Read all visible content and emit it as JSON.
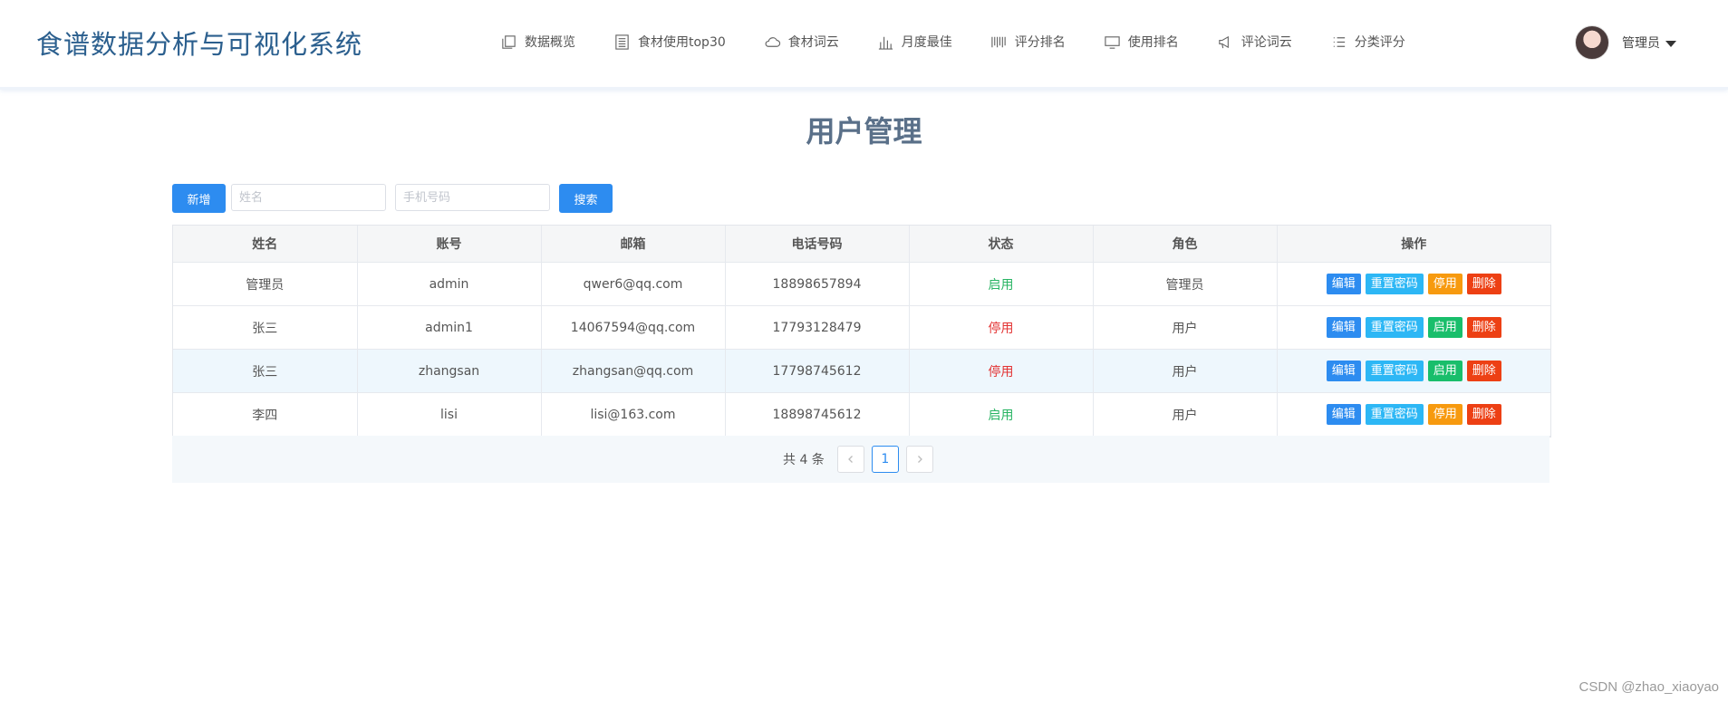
{
  "header": {
    "brand": "食谱数据分析与可视化系统",
    "nav": [
      {
        "label": "数据概览",
        "icon": "copy-icon"
      },
      {
        "label": "食材使用top30",
        "icon": "list-icon"
      },
      {
        "label": "食材词云",
        "icon": "cloud-icon"
      },
      {
        "label": "月度最佳",
        "icon": "bar-chart-icon"
      },
      {
        "label": "评分排名",
        "icon": "barcode-icon"
      },
      {
        "label": "使用排名",
        "icon": "monitor-icon"
      },
      {
        "label": "评论词云",
        "icon": "megaphone-icon"
      },
      {
        "label": "分类评分",
        "icon": "menu-list-icon"
      }
    ],
    "user": {
      "name": "管理员"
    }
  },
  "page": {
    "title": "用户管理"
  },
  "toolbar": {
    "add_label": "新增",
    "name_placeholder": "姓名",
    "phone_placeholder": "手机号码",
    "search_label": "搜索"
  },
  "table": {
    "columns": [
      "姓名",
      "账号",
      "邮箱",
      "电话号码",
      "状态",
      "角色",
      "操作"
    ],
    "rows": [
      {
        "name": "管理员",
        "account": "admin",
        "email": "qwer6@qq.com",
        "phone": "18898657894",
        "status": "启用",
        "role": "管理员",
        "toggle": "停用"
      },
      {
        "name": "张三",
        "account": "admin1",
        "email": "14067594@qq.com",
        "phone": "17793128479",
        "status": "停用",
        "role": "用户",
        "toggle": "启用"
      },
      {
        "name": "张三",
        "account": "zhangsan",
        "email": "zhangsan@qq.com",
        "phone": "17798745612",
        "status": "停用",
        "role": "用户",
        "toggle": "启用"
      },
      {
        "name": "李四",
        "account": "lisi",
        "email": "lisi@163.com",
        "phone": "18898745612",
        "status": "启用",
        "role": "用户",
        "toggle": "停用"
      }
    ],
    "actions": {
      "edit": "编辑",
      "reset": "重置密码",
      "delete": "删除"
    }
  },
  "pagination": {
    "total": "共 4 条",
    "current": "1"
  },
  "watermark": "CSDN @zhao_xiaoyao",
  "colors": {
    "primary": "#2d8cf0",
    "enabled": "#28b463",
    "disabled": "#e33333",
    "brand": "#2b5f8e"
  }
}
